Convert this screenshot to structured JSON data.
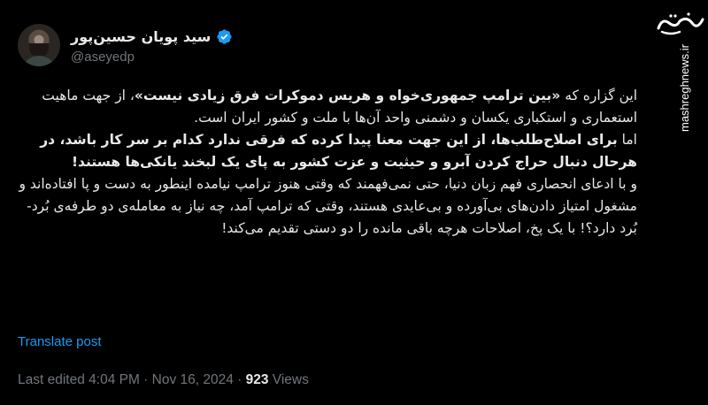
{
  "author": {
    "display_name": "سید پویان حسین‌پور",
    "handle": "@aseyedp"
  },
  "tweet": {
    "paragraphs": [
      {
        "plain_before": "این گزاره که ",
        "bold": "«بین ترامپ جمهوری‌خواه و هریس دموکرات فرق زیادی نیست»",
        "plain_after": "، از جهت ماهیت استعماری و استکباری یکسان و دشمنی واحد آن‌ها با ملت و کشور ایران است."
      },
      {
        "plain_before": "اما ",
        "bold": "برای اصلاح‌طلب‌ها، از این جهت معنا پیدا کرده که فرقی ندارد کدام بر سر کار باشد، در هرحال دنبال حراج کردن آبرو و حیثیت و عزت کشور به پای یک لبخند یانکی‌ها هستند!",
        "plain_after": ""
      },
      {
        "plain_before": "و با ادعای انحصاری فهم زبان دنیا، حتی نمی‌فهمند که وقتی هنوز ترامپ نیامده اینطور به دست و پا افتاده‌اند و مشغول امتیاز دادن‌های بی‌آورده و بی‌عایدی هستند، وقتی که ترامپ آمد، چه نیاز به معامله‌ی دو طرفه‌ی بُرد-بُرد دارد؟! با یک پخ، اصلاحات هرچه باقی مانده را دو دستی تقدیم می‌کند!",
        "bold": "",
        "plain_after": ""
      }
    ],
    "translate_label": "Translate post",
    "meta": {
      "edited": "Last edited 4:04 PM · Nov 16, 2024 · ",
      "views_count": "923",
      "views_label": " Views"
    }
  },
  "watermark": {
    "logo_text": "مشرق",
    "site_url": "mashreghnews.ir"
  },
  "colors": {
    "background": "#000000",
    "text": "#e7e9ea",
    "muted": "#71767b",
    "link": "#1d9bf0",
    "verified": "#1d9bf0"
  }
}
